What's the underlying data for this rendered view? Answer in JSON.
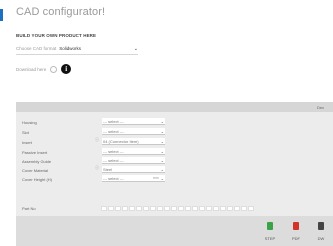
{
  "page": {
    "title": "CAD configurator!"
  },
  "section": {
    "heading": "BUILD YOUR OWN PRODUCT HERE"
  },
  "format": {
    "label": "Choose CAD format",
    "value": "Solidworks"
  },
  "download": {
    "label": "Download here"
  },
  "panel": {
    "header_tab": "Dec",
    "params": [
      {
        "label": "Housing",
        "value": "--- select ---",
        "has_icon": false
      },
      {
        "label": "Slot",
        "value": "--- select ---",
        "has_icon": false
      },
      {
        "label": "Insert",
        "value": "04 (Connector Item)",
        "has_icon": true
      },
      {
        "label": "Passive Insert",
        "value": "--- select ---",
        "has_icon": false
      },
      {
        "label": "Assembly Guide",
        "value": "--- select ---",
        "has_icon": false
      },
      {
        "label": "Cover Material",
        "value": "Steel",
        "has_icon": true
      },
      {
        "label": "Cover Height (H)",
        "value": "--- select ---",
        "unit": "mm",
        "has_icon": false
      }
    ],
    "part_no": {
      "label": "Part No",
      "boxes": [
        "",
        "",
        "",
        "",
        "",
        "",
        "",
        "",
        "",
        "",
        "",
        "",
        "",
        "",
        "",
        "",
        "",
        "",
        "",
        "",
        "",
        ""
      ]
    },
    "downloads": [
      {
        "label": "STEP",
        "icon": "step-file-icon",
        "color": "#3aa34a"
      },
      {
        "label": "PDF",
        "icon": "pdf-file-icon",
        "color": "#d2342c"
      },
      {
        "label": "DW",
        "icon": "dwg-file-icon",
        "color": "#444444"
      }
    ]
  }
}
